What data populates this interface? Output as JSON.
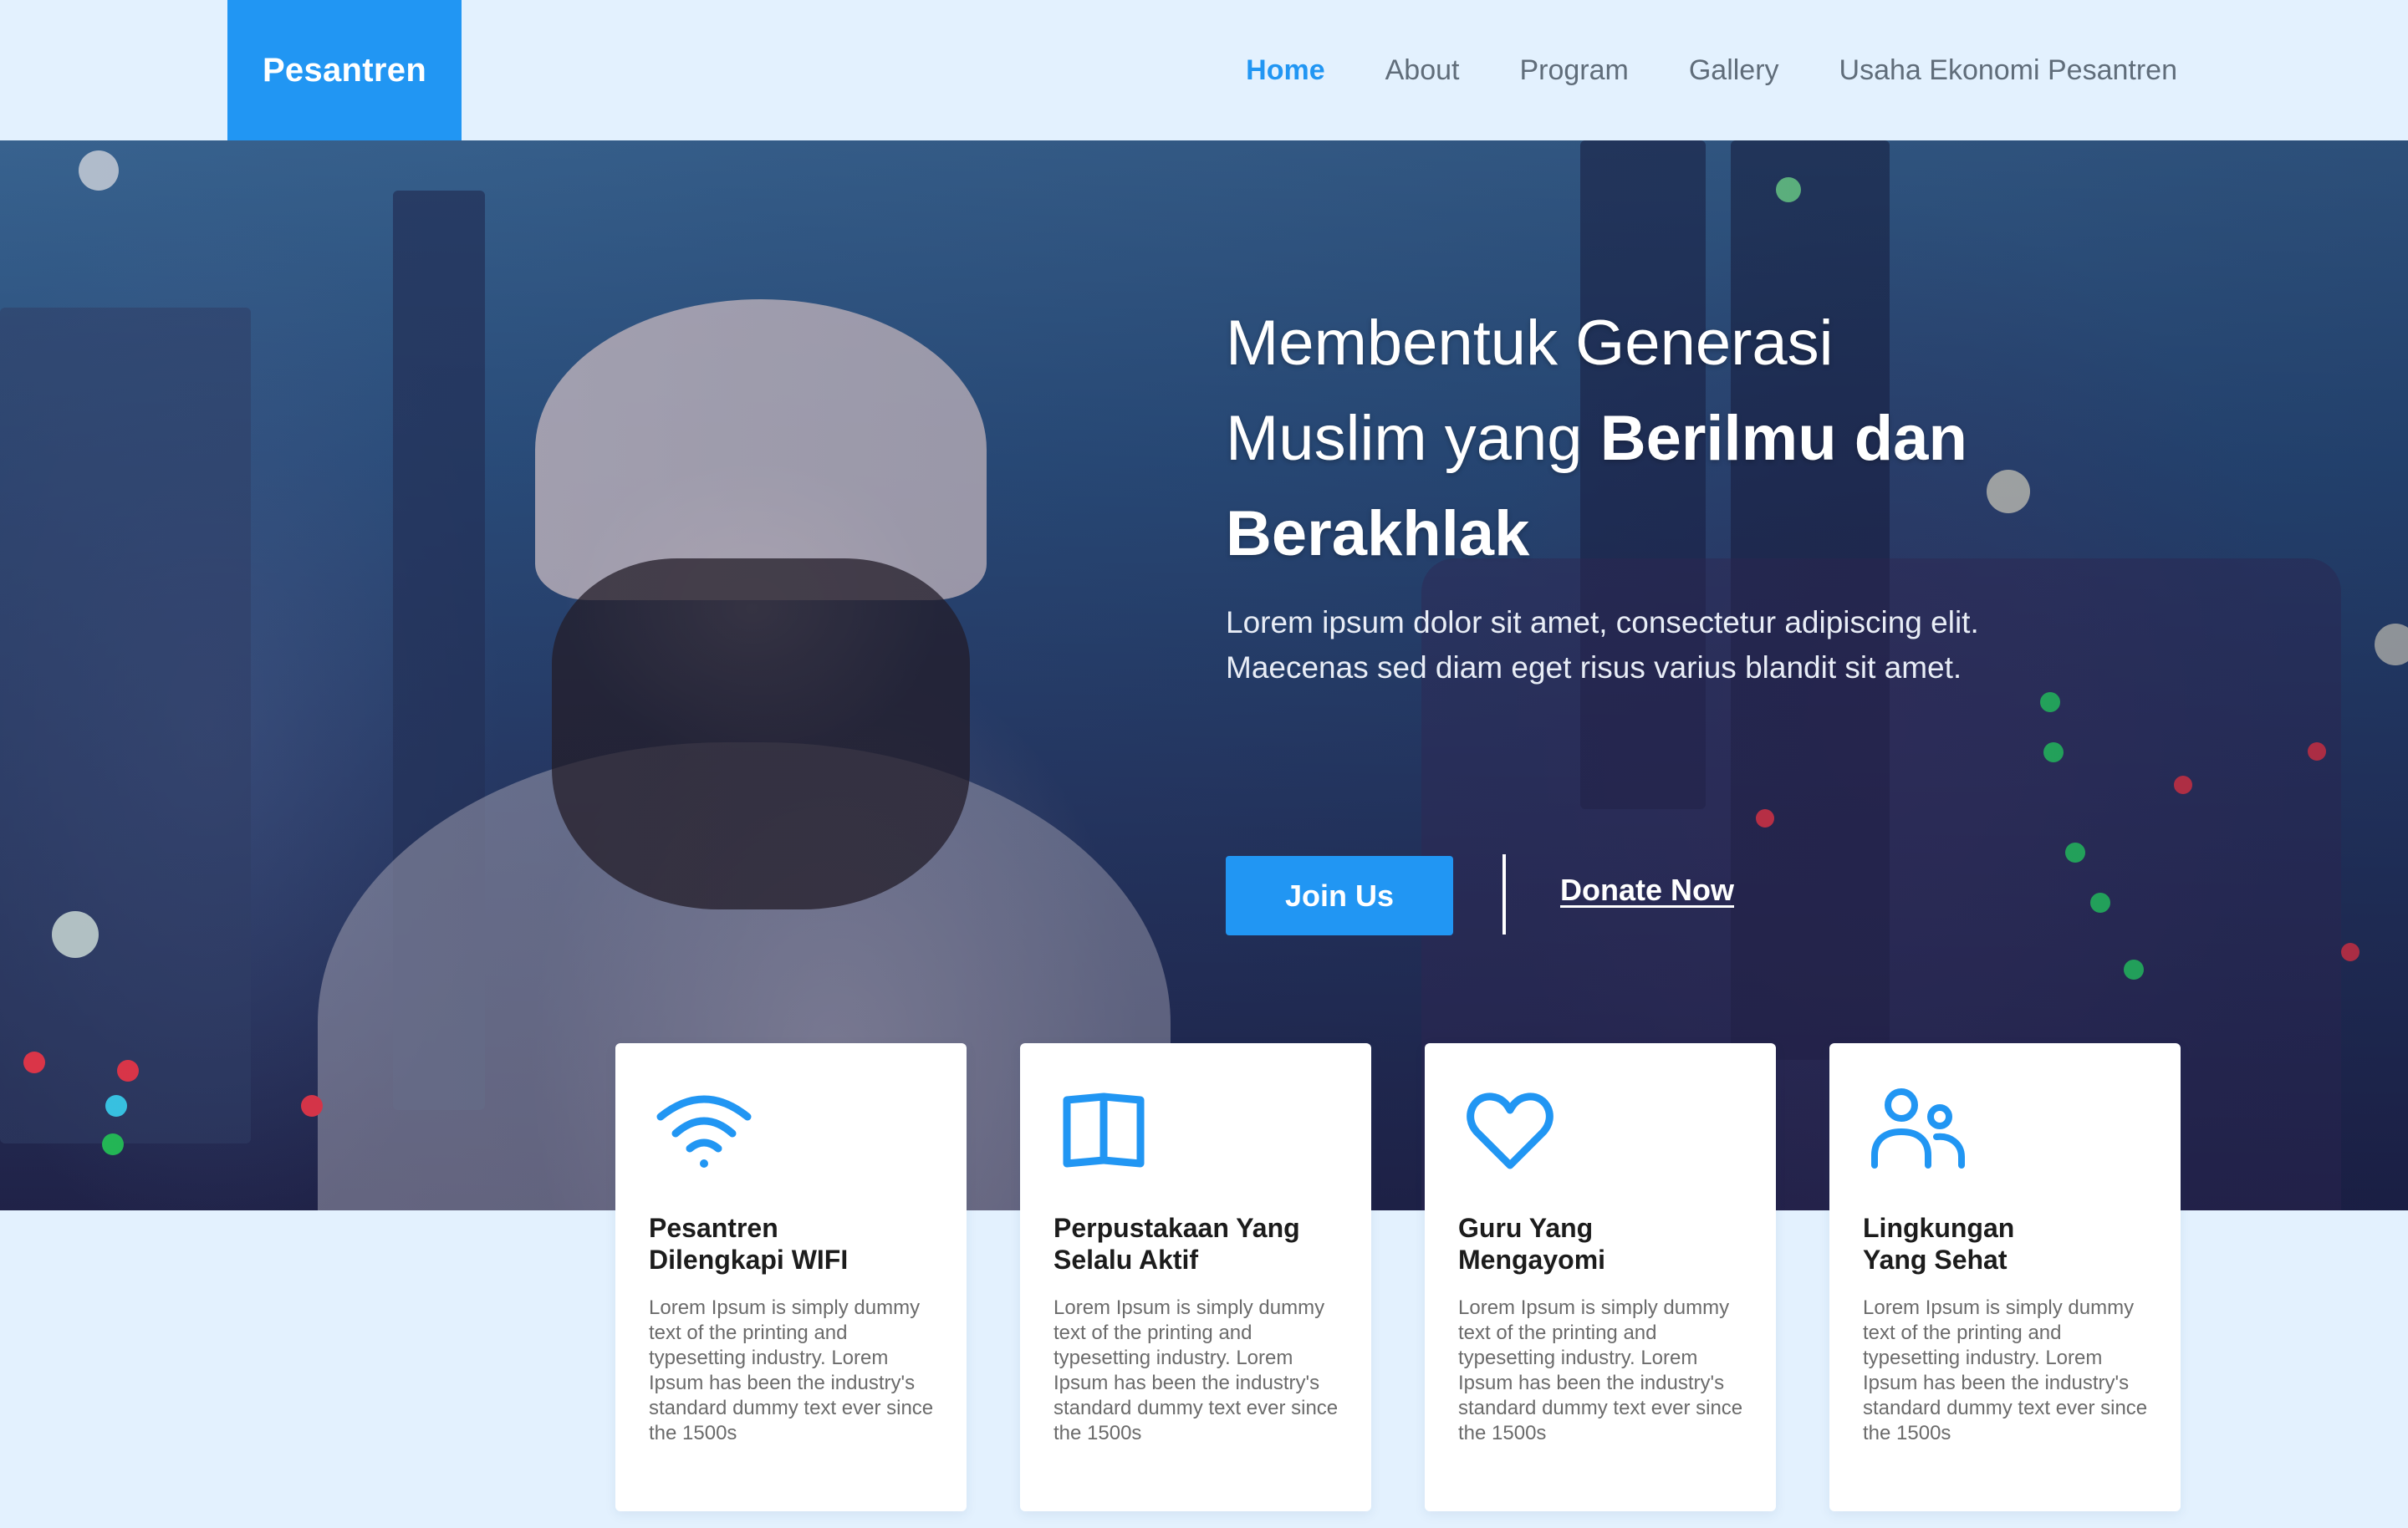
{
  "header": {
    "logo": "Pesantren",
    "nav": [
      {
        "label": "Home",
        "active": true
      },
      {
        "label": "About",
        "active": false
      },
      {
        "label": "Program",
        "active": false
      },
      {
        "label": "Gallery",
        "active": false
      },
      {
        "label": "Usaha Ekonomi Pesantren",
        "active": false
      }
    ]
  },
  "hero": {
    "title_line1": "Membentuk Generasi",
    "title_line2_regular": "Muslim yang ",
    "title_line2_bold": "Berilmu dan",
    "title_line3_bold": "Berakhlak",
    "subtitle_line1": "Lorem ipsum dolor sit amet, consectetur adipiscing elit.",
    "subtitle_line2": "Maecenas sed diam eget risus varius blandit sit amet.",
    "join_label": "Join Us",
    "donate_label": "Donate Now"
  },
  "features": [
    {
      "icon": "wifi-icon",
      "title_line1": "Pesantren",
      "title_line2": "Dilengkapi WIFI",
      "text": "Lorem Ipsum is simply dummy text of the printing and typesetting industry. Lorem Ipsum has been the industry's standard dummy text ever since the 1500s"
    },
    {
      "icon": "book-icon",
      "title_line1": "Perpustakaan Yang",
      "title_line2": "Selalu Aktif",
      "text": "Lorem Ipsum is simply dummy text of the printing and typesetting industry. Lorem Ipsum has been the industry's standard dummy text ever since the 1500s"
    },
    {
      "icon": "heart-icon",
      "title_line1": "Guru Yang",
      "title_line2": "Mengayomi",
      "text": "Lorem Ipsum is simply dummy text of the printing and typesetting industry. Lorem Ipsum has been the industry's standard dummy text ever since the 1500s"
    },
    {
      "icon": "users-icon",
      "title_line1": "Lingkungan",
      "title_line2": "Yang Sehat",
      "text": "Lorem Ipsum is simply dummy text of the printing and typesetting industry. Lorem Ipsum has been the industry's standard dummy text ever since the 1500s"
    }
  ],
  "colors": {
    "accent": "#2196f3",
    "page_background": "#e3f1fe",
    "nav_text": "#606d7a",
    "card_title": "#1c1c1c",
    "card_text": "#6b6b6b"
  }
}
